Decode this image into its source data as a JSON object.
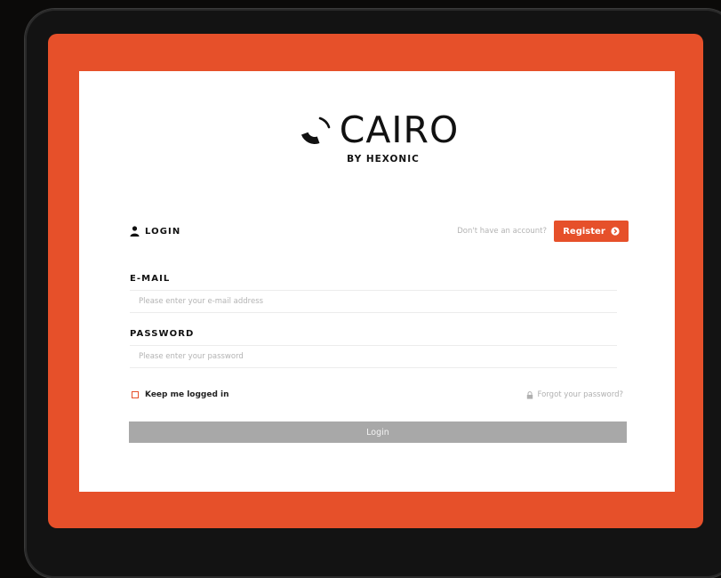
{
  "colors": {
    "accent": "#e6502a",
    "background": "#0b0a09",
    "panel": "#ffffff",
    "login_button": "#a8a8a8"
  },
  "brand": {
    "name": "CAIRO",
    "tagline": "BY HEXONIC",
    "logo_icon": "cairo-logo-mark"
  },
  "login_header": {
    "icon": "user-icon",
    "label": "LOGIN"
  },
  "register": {
    "hint": "Don't have an account?",
    "button_label": "Register",
    "button_icon": "arrow-circle-right-icon"
  },
  "email": {
    "label": "E-MAIL",
    "placeholder": "Please enter your e-mail address"
  },
  "password": {
    "label": "PASSWORD",
    "placeholder": "Please enter your password"
  },
  "remember": {
    "label": "Keep me logged in",
    "checked": false
  },
  "forgot": {
    "icon": "lock-icon",
    "label": "Forgot your password?"
  },
  "submit": {
    "label": "Login"
  }
}
